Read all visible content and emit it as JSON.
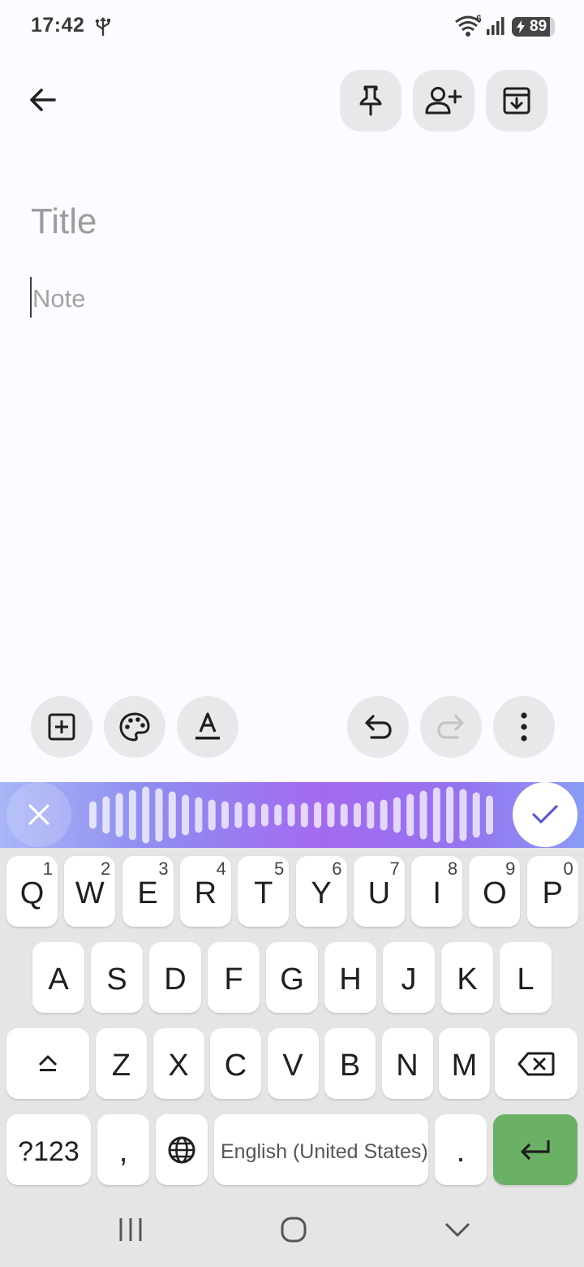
{
  "status": {
    "time": "17:42",
    "wifi_badge": "6",
    "battery": "89",
    "battery_level": 0.89
  },
  "toolbar": {
    "back_icon": "arrow-left-icon",
    "pin_icon": "pin-icon",
    "collaborator_icon": "person-add-icon",
    "archive_icon": "archive-icon"
  },
  "editor": {
    "title_placeholder": "Title",
    "note_placeholder": "Note",
    "title_value": "",
    "note_value": ""
  },
  "bottom_tools": {
    "add_icon": "add-box-icon",
    "palette_icon": "palette-icon",
    "text_format_icon": "text-format-icon",
    "undo_icon": "undo-icon",
    "redo_icon": "redo-icon",
    "more_icon": "more-vert-icon"
  },
  "voice": {
    "close_icon": "close-icon",
    "done_icon": "check-icon",
    "accent": "#5b57d6"
  },
  "keyboard": {
    "row1": [
      {
        "key": "Q",
        "sub": "1"
      },
      {
        "key": "W",
        "sub": "2"
      },
      {
        "key": "E",
        "sub": "3"
      },
      {
        "key": "R",
        "sub": "4"
      },
      {
        "key": "T",
        "sub": "5"
      },
      {
        "key": "Y",
        "sub": "6"
      },
      {
        "key": "U",
        "sub": "7"
      },
      {
        "key": "I",
        "sub": "8"
      },
      {
        "key": "O",
        "sub": "9"
      },
      {
        "key": "P",
        "sub": "0"
      }
    ],
    "row2": [
      "A",
      "S",
      "D",
      "F",
      "G",
      "H",
      "J",
      "K",
      "L"
    ],
    "row3": [
      "Z",
      "X",
      "C",
      "V",
      "B",
      "N",
      "M"
    ],
    "symbols_label": "?123",
    "comma": ",",
    "period": ".",
    "space_label": "English (United States)",
    "enter_color": "#6ab165"
  },
  "navbar": {
    "recents_icon": "recents-icon",
    "home_icon": "home-icon",
    "back_icon": "chevron-down-icon"
  }
}
